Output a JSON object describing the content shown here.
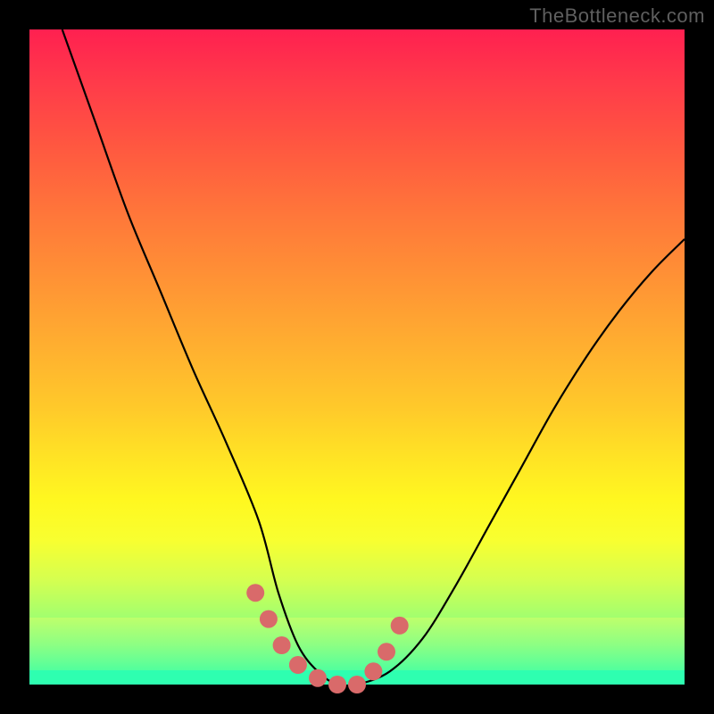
{
  "watermark": "TheBottleneck.com",
  "chart_data": {
    "type": "line",
    "title": "",
    "xlabel": "",
    "ylabel": "",
    "xlim": [
      0,
      100
    ],
    "ylim": [
      0,
      100
    ],
    "grid": false,
    "legend": "none",
    "series": [
      {
        "name": "bottleneck-curve",
        "x": [
          5,
          10,
          15,
          20,
          25,
          30,
          35,
          38,
          41,
          44,
          47,
          50,
          55,
          60,
          65,
          70,
          75,
          80,
          85,
          90,
          95,
          100
        ],
        "values": [
          100,
          86,
          72,
          60,
          48,
          37,
          25,
          14,
          6,
          2,
          0,
          0,
          2,
          7,
          15,
          24,
          33,
          42,
          50,
          57,
          63,
          68
        ]
      }
    ],
    "highlight_points": {
      "name": "marker-points",
      "x": [
        34.5,
        36.5,
        38.5,
        41,
        44,
        47,
        50,
        52.5,
        54.5,
        56.5
      ],
      "values": [
        14,
        10,
        6,
        3,
        1,
        0,
        0,
        2,
        5,
        9
      ]
    },
    "background_gradient": {
      "top": "#ff2050",
      "mid": "#ffe225",
      "bottom": "#2effb0"
    }
  }
}
